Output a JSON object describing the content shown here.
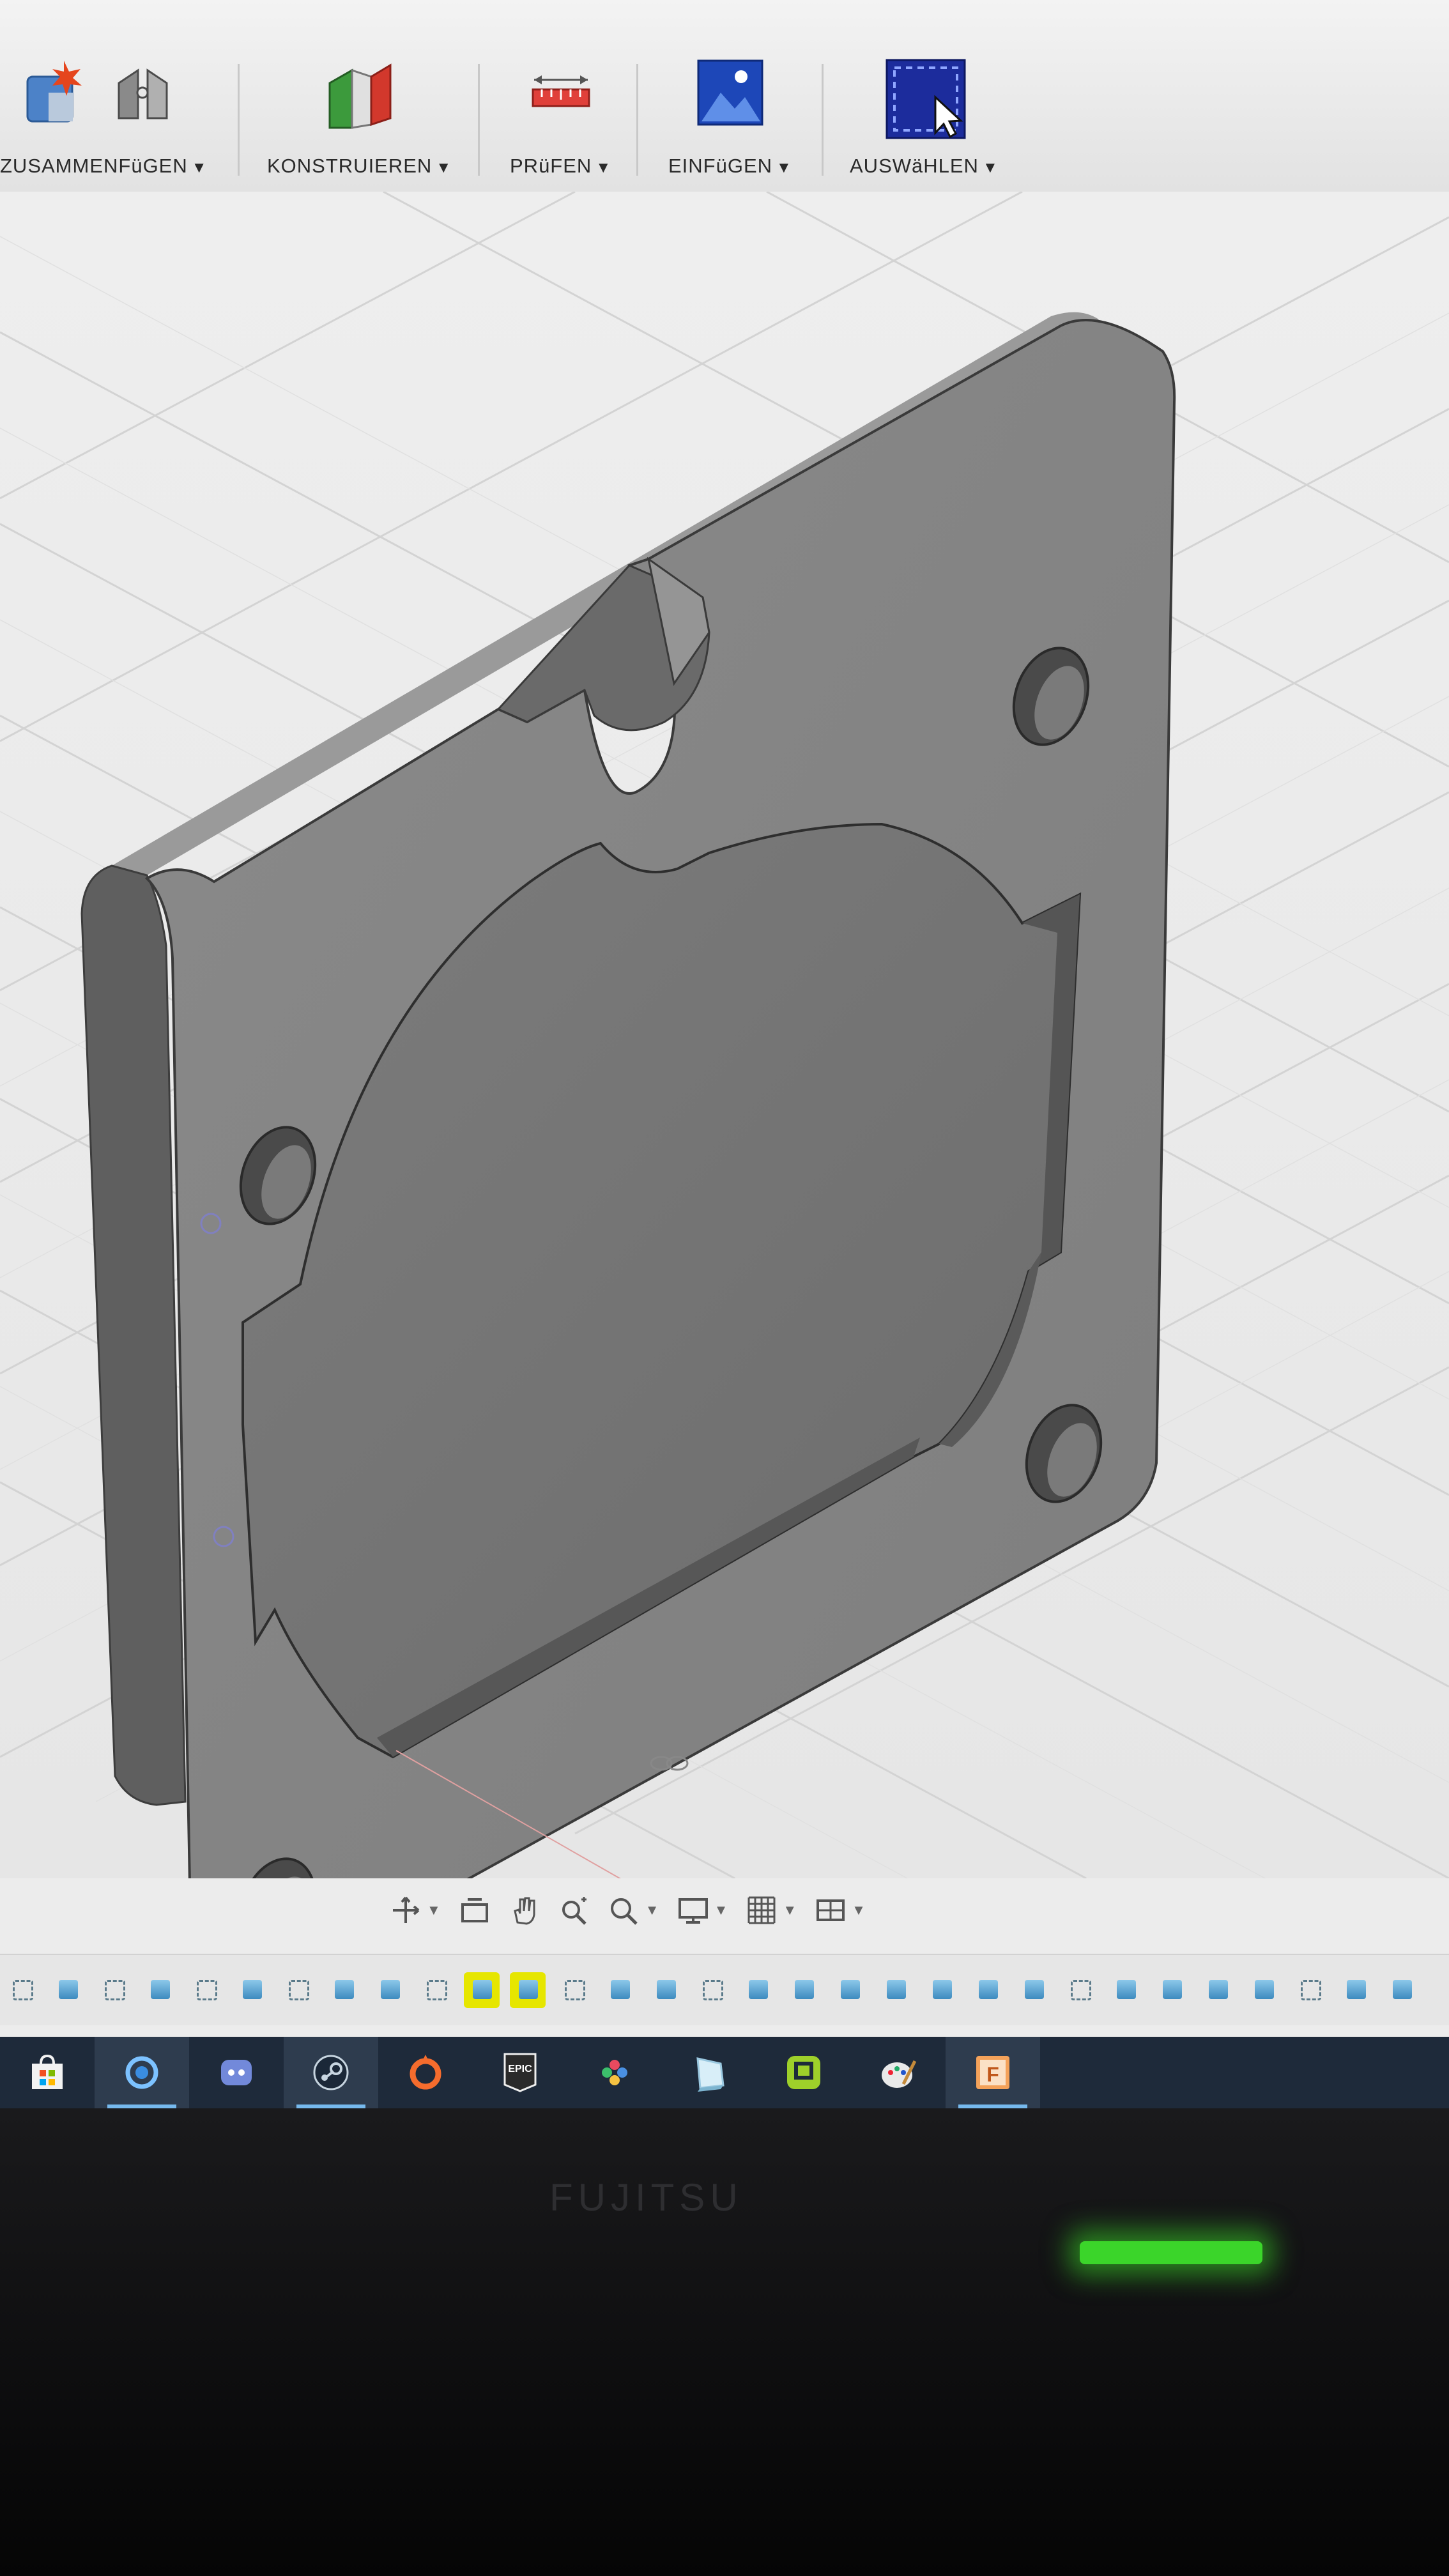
{
  "toolbar": {
    "groups": [
      {
        "label": "ZUSAMMENFüGEN"
      },
      {
        "label": "KONSTRUIEREN"
      },
      {
        "label": "PRüFEN"
      },
      {
        "label": "EINFüGEN"
      },
      {
        "label": "AUSWäHLEN"
      }
    ],
    "caret": "▼"
  },
  "viewport": {
    "model": "plate-with-recess",
    "part_color": "#8a8a8a",
    "grid_color": "#d2d2d2"
  },
  "navbar": {
    "icons": [
      "orbit-icon",
      "look-at-icon",
      "pan-icon",
      "zoom-icon",
      "fit-icon",
      "display-settings-icon",
      "grid-settings-icon",
      "viewports-icon"
    ]
  },
  "timeline": {
    "highlighted": [
      9,
      10
    ],
    "count": 31
  },
  "taskbar": {
    "apps": [
      "store-icon",
      "sync-icon",
      "discord-icon",
      "steam-icon",
      "origin-icon",
      "epic-games-icon",
      "controller-icon",
      "cube-app-icon",
      "puzzle-app-icon",
      "paint-icon",
      "fusion-icon"
    ],
    "epic_text": "EPIC",
    "fusion_letter": "F"
  },
  "monitor": {
    "brand": "FUJITSU",
    "led_color": "#3bd52a"
  }
}
